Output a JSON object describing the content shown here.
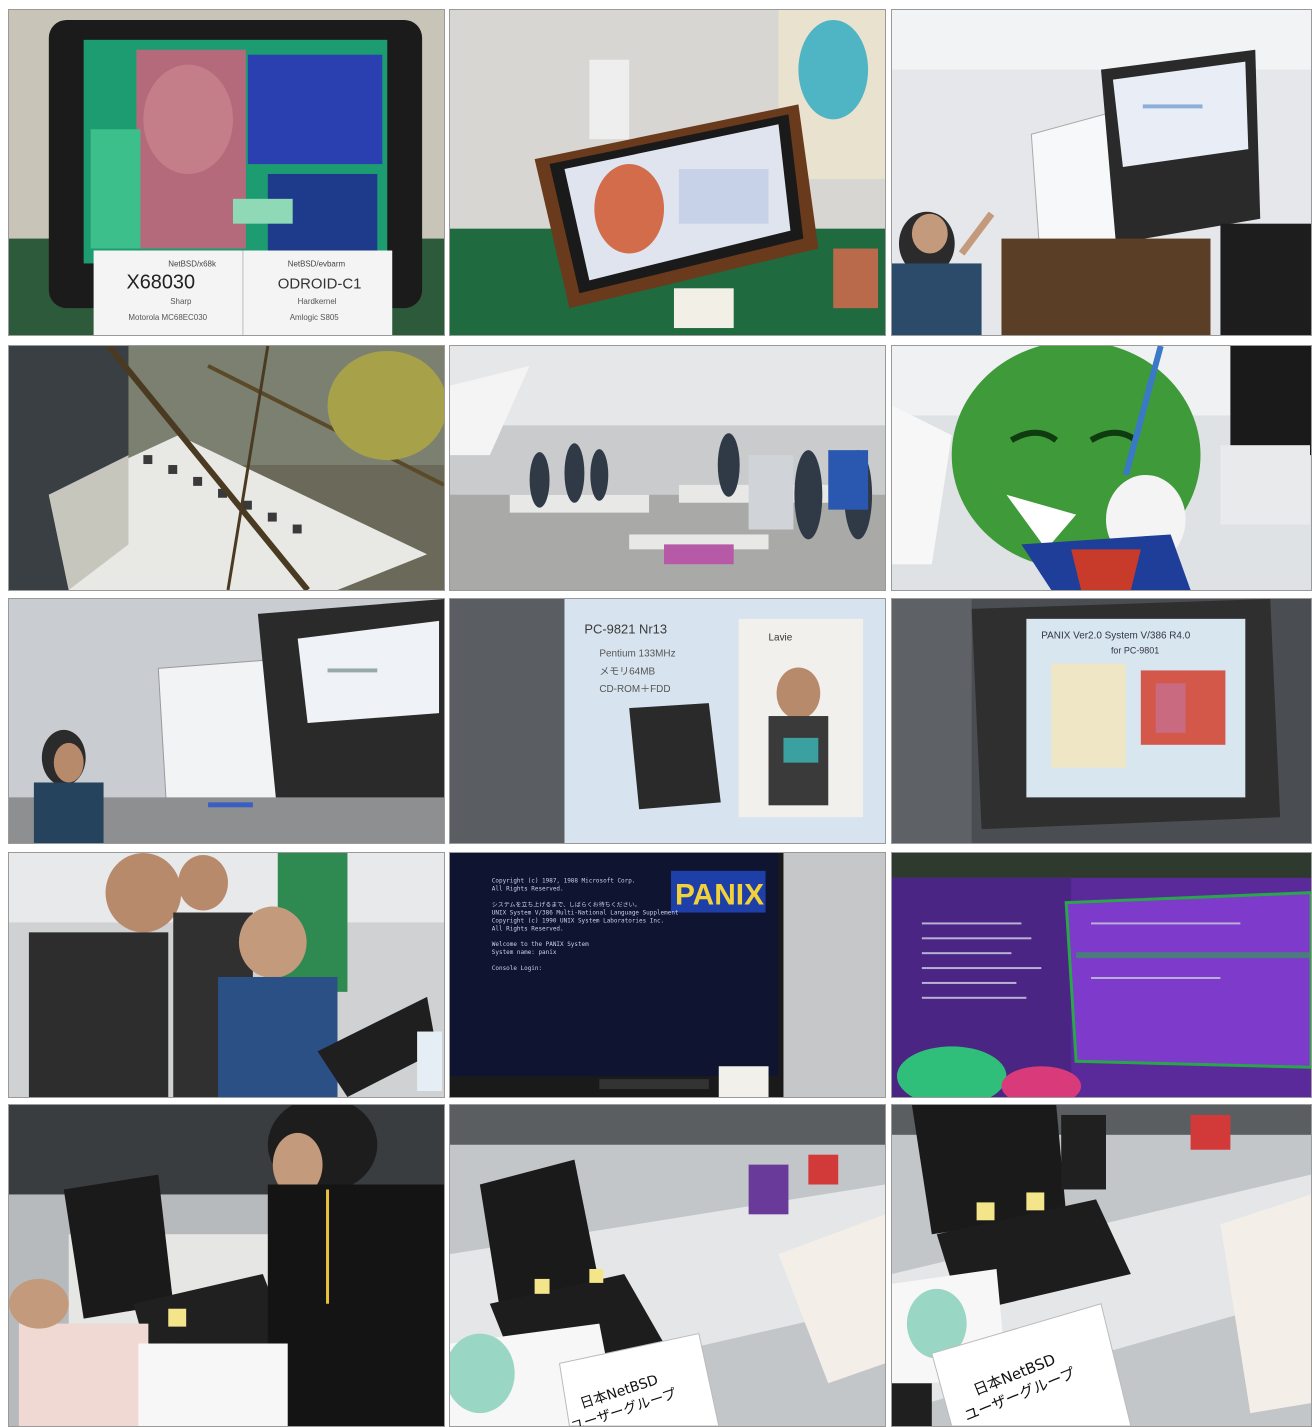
{
  "photos": [
    {
      "label_left": {
        "top": "NetBSD/x68k",
        "model": "X68030",
        "maker": "Sharp",
        "cpu": "Motorola MC68EC030"
      },
      "label_right": {
        "top": "NetBSD/evbarm",
        "model": "ODROID-C1",
        "maker": "Hardkernel",
        "cpu": "Amlogic S805"
      }
    },
    {},
    {},
    {},
    {},
    {},
    {},
    {
      "slide_bullet": "PC-9821 Nr13",
      "slide_items": [
        "Pentium 133MHz",
        "メモリ64MB",
        "CD-ROM＋FDD"
      ],
      "slide_box_label": "Lavie"
    },
    {
      "slide_title": "PANIX Ver2.0 System V/386 R4.0",
      "slide_subtitle": "for PC-9801"
    },
    {},
    {
      "banner": "PANIX",
      "boot_lines": [
        "Copyright (c) 1987, 1988 Microsoft Corp.",
        "All Rights Reserved.",
        "",
        "システムを立ち上げるまで、しばらくお待ちください。",
        "UNIX System V/386 Multi-National Language Supplement",
        "Copyright (c) 1990 UNIX System Laboratories Inc.",
        "All Rights Reserved.",
        "",
        "Welcome to the PANIX System",
        "System name: panix",
        "",
        "Console Login:"
      ]
    },
    {},
    {},
    {
      "sign_line1": "日本NetBSD",
      "sign_line2": "ユーザーグループ"
    },
    {
      "sign_line1": "日本NetBSD",
      "sign_line2": "ユーザーグループ"
    }
  ]
}
